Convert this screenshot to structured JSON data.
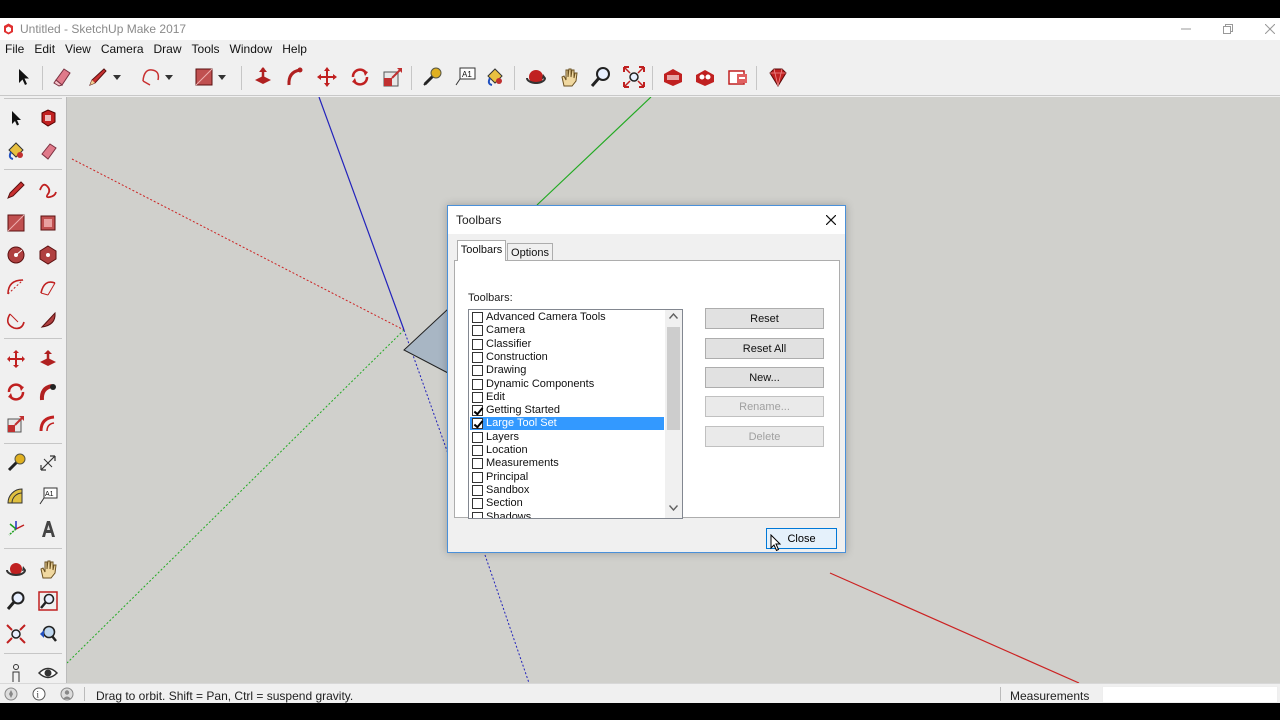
{
  "window": {
    "title": "Untitled - SketchUp Make 2017",
    "controls": [
      "minimize",
      "maximize",
      "close"
    ]
  },
  "menu": [
    "File",
    "Edit",
    "View",
    "Camera",
    "Draw",
    "Tools",
    "Window",
    "Help"
  ],
  "top_toolbar": {
    "tools": [
      "select-icon",
      "eraser-icon",
      "pencil-icon",
      "arc-icon",
      "rectangle-icon",
      "push-pull-icon",
      "follow-me-icon",
      "move-icon",
      "rotate-icon",
      "scale-icon",
      "tape-measure-icon",
      "text-icon",
      "paint-bucket-icon",
      "orbit-icon",
      "pan-icon",
      "zoom-icon",
      "zoom-extents-icon",
      "3d-warehouse-icon",
      "extension-warehouse-icon",
      "send-to-layout-icon",
      "extension-manager-icon"
    ]
  },
  "left_toolbar": {
    "tools": [
      "select-icon",
      "make-component-icon",
      "paint-bucket-icon",
      "eraser-icon",
      "line-icon",
      "freehand-icon",
      "rectangle-icon",
      "rotated-rectangle-icon",
      "circle-icon",
      "polygon-icon",
      "arc-icon",
      "two-point-arc-icon",
      "three-point-arc-icon",
      "pie-icon",
      "move-icon",
      "push-pull-icon",
      "rotate-icon",
      "follow-me-icon",
      "scale-icon",
      "offset-icon",
      "tape-measure-icon",
      "dimensions-icon",
      "protractor-icon",
      "text-icon",
      "axes-icon",
      "3d-text-icon",
      "orbit-icon",
      "pan-icon",
      "zoom-icon",
      "zoom-window-icon",
      "zoom-extents-icon",
      "previous-view-icon",
      "position-camera-icon",
      "look-around-icon"
    ]
  },
  "dialog": {
    "title": "Toolbars",
    "tabs": [
      "Toolbars",
      "Options"
    ],
    "list_label": "Toolbars:",
    "items": [
      {
        "label": "Advanced Camera Tools",
        "checked": false,
        "selected": false
      },
      {
        "label": "Camera",
        "checked": false,
        "selected": false
      },
      {
        "label": "Classifier",
        "checked": false,
        "selected": false
      },
      {
        "label": "Construction",
        "checked": false,
        "selected": false
      },
      {
        "label": "Drawing",
        "checked": false,
        "selected": false
      },
      {
        "label": "Dynamic Components",
        "checked": false,
        "selected": false
      },
      {
        "label": "Edit",
        "checked": false,
        "selected": false
      },
      {
        "label": "Getting Started",
        "checked": true,
        "selected": false
      },
      {
        "label": "Large Tool Set",
        "checked": true,
        "selected": true
      },
      {
        "label": "Layers",
        "checked": false,
        "selected": false
      },
      {
        "label": "Location",
        "checked": false,
        "selected": false
      },
      {
        "label": "Measurements",
        "checked": false,
        "selected": false
      },
      {
        "label": "Principal",
        "checked": false,
        "selected": false
      },
      {
        "label": "Sandbox",
        "checked": false,
        "selected": false
      },
      {
        "label": "Section",
        "checked": false,
        "selected": false
      },
      {
        "label": "Shadows",
        "checked": false,
        "selected": false
      }
    ],
    "buttons": {
      "reset": "Reset",
      "reset_all": "Reset All",
      "new": "New...",
      "rename": "Rename...",
      "delete": "Delete",
      "close": "Close"
    }
  },
  "status": {
    "hint": "Drag to orbit. Shift = Pan, Ctrl = suspend gravity.",
    "measurements_label": "Measurements",
    "measurements_value": ""
  },
  "colors": {
    "axis_red": "#cc2222",
    "axis_green": "#22aa22",
    "axis_blue": "#2222bb",
    "selection": "#3399ff",
    "viewport_bg": "#d0d0cc"
  }
}
